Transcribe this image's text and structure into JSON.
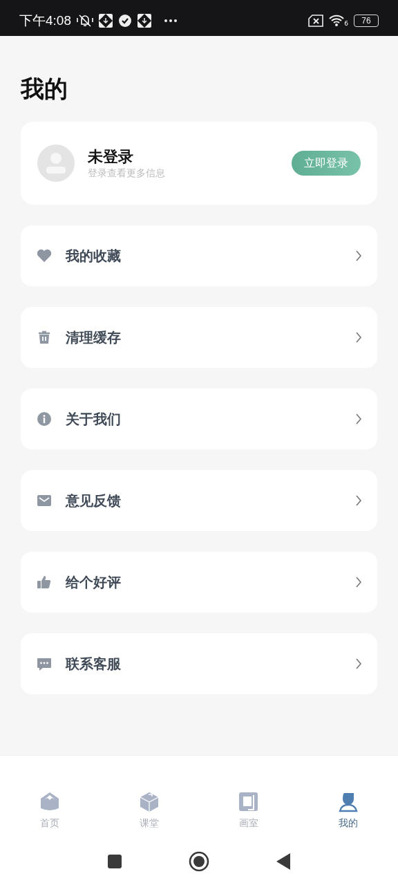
{
  "status_bar": {
    "time": "下午4:08",
    "wifi_label": "6",
    "battery": "76"
  },
  "title": "我的",
  "profile": {
    "name": "未登录",
    "subtitle": "登录查看更多信息",
    "login_button": "立即登录"
  },
  "menu": [
    {
      "label": "我的收藏",
      "kind": "heart"
    },
    {
      "label": "清理缓存",
      "kind": "trash"
    },
    {
      "label": "关于我们",
      "kind": "info"
    },
    {
      "label": "意见反馈",
      "kind": "mail"
    },
    {
      "label": "给个好评",
      "kind": "thumb"
    },
    {
      "label": "联系客服",
      "kind": "chat"
    }
  ],
  "tabs": [
    {
      "label": "首页",
      "kind": "home",
      "selected": false
    },
    {
      "label": "课堂",
      "kind": "box",
      "selected": false
    },
    {
      "label": "画室",
      "kind": "studio",
      "selected": false
    },
    {
      "label": "我的",
      "kind": "me",
      "selected": true
    }
  ]
}
